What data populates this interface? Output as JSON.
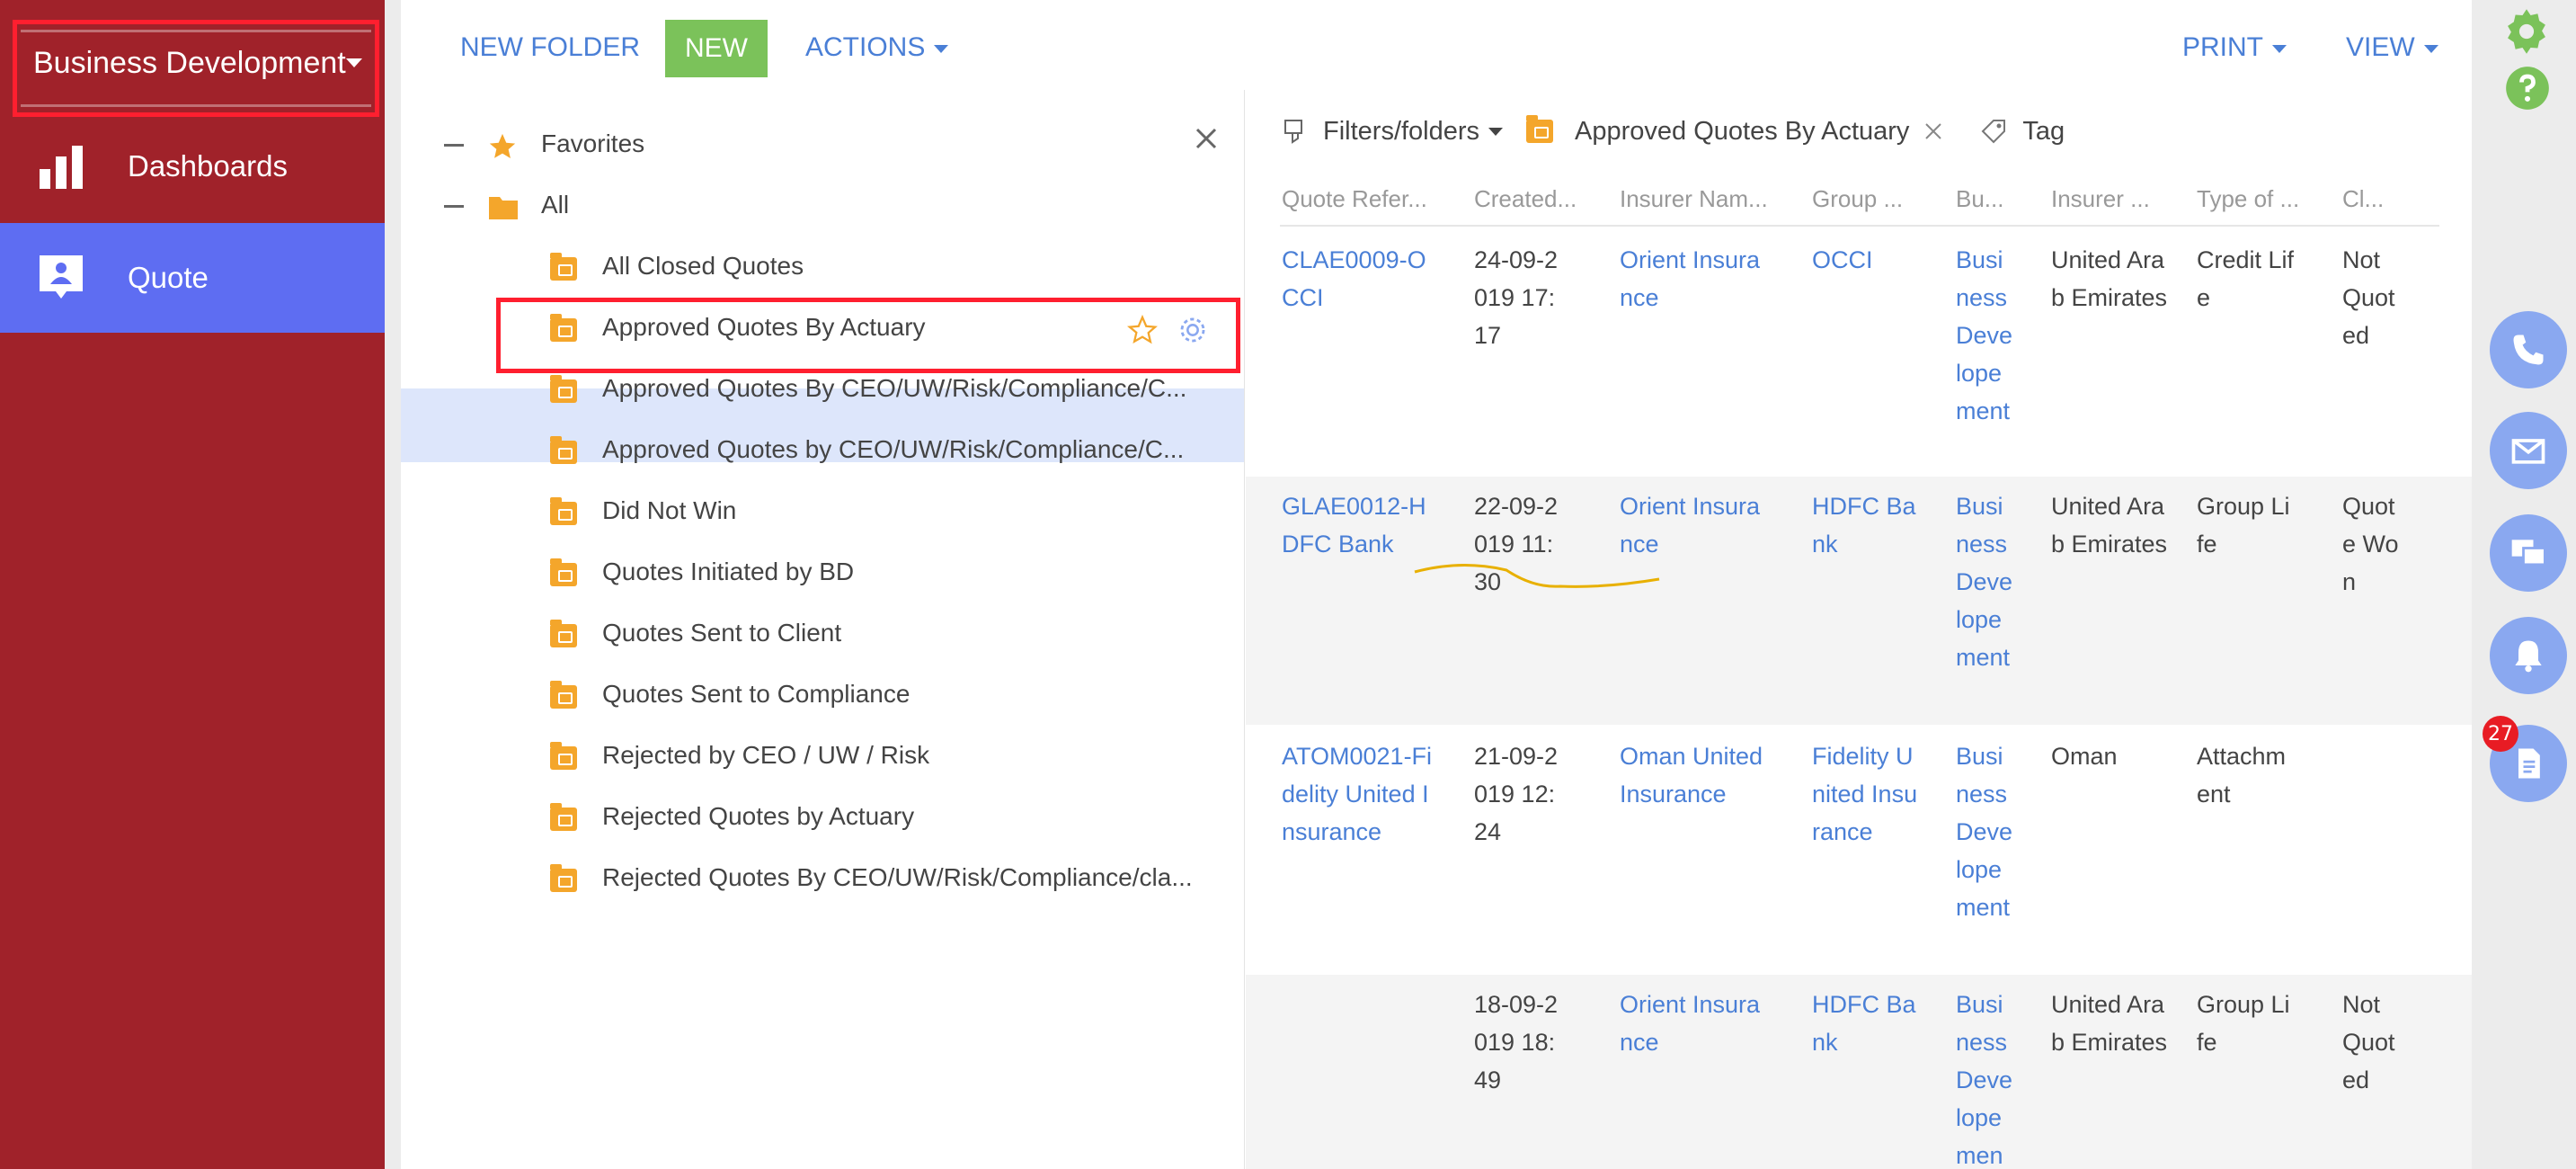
{
  "sidebar": {
    "workspace": "Business Development",
    "items": [
      {
        "label": "Dashboards"
      },
      {
        "label": "Quote"
      }
    ]
  },
  "toolbar": {
    "new_folder": "NEW FOLDER",
    "new": "NEW",
    "actions": "ACTIONS",
    "print": "PRINT",
    "view": "VIEW"
  },
  "folders": {
    "favorites": "Favorites",
    "all": "All",
    "items": [
      "All Closed Quotes",
      "Approved Quotes By Actuary",
      "Approved Quotes By CEO/UW/Risk/Compliance/C...",
      "Approved Quotes by CEO/UW/Risk/Compliance/C...",
      "Did Not Win",
      "Quotes Initiated by BD",
      "Quotes Sent to Client",
      "Quotes Sent to Compliance",
      "Rejected by CEO / UW / Risk",
      "Rejected Quotes by Actuary",
      "Rejected Quotes By CEO/UW/Risk/Compliance/cla..."
    ]
  },
  "filters": {
    "filters_folders": "Filters/folders",
    "active_folder": "Approved Quotes By Actuary",
    "tag": "Tag"
  },
  "grid": {
    "columns": [
      "Quote Refer...",
      "Created...",
      "Insurer Nam...",
      "Group ...",
      "Bu...",
      "Insurer ...",
      "Type of ...",
      "Cl..."
    ],
    "rows": [
      {
        "ref": "CLAE0009-OCCI",
        "created": "24-09-2019 17:17",
        "insurer": "Orient Insurance",
        "group": "OCCI",
        "bu": "Business Developement",
        "country": "United Arab Emirates",
        "type": "Credit Life",
        "status": "Not Quoted"
      },
      {
        "ref": "GLAE0012-HDFC Bank",
        "created": "22-09-2019 11:30",
        "insurer": "Orient Insurance",
        "group": "HDFC Bank",
        "bu": "Business Developement",
        "country": "United Arab Emirates",
        "type": "Group Life",
        "status": "Quote Won"
      },
      {
        "ref": "ATOM0021-Fidelity United Insurance",
        "created": "21-09-2019 12:24",
        "insurer": "Oman United Insurance",
        "group": "Fidelity United Insurance",
        "bu": "Business Developement",
        "country": "Oman",
        "type": "Attachment",
        "status": ""
      },
      {
        "ref": "",
        "created": "18-09-2019 18:49",
        "insurer": "Orient Insurance",
        "group": "HDFC Bank",
        "bu": "Business Developemen",
        "country": "United Arab Emirates",
        "type": "Group Life",
        "status": "Not Quoted"
      }
    ]
  },
  "rail": {
    "badge_count": "27"
  },
  "colors": {
    "sidebar": "#a0222a",
    "active_nav": "#5e6df2",
    "link": "#4a7fd6",
    "new_button": "#7bc25a",
    "folder": "#f4a62b",
    "highlight_box": "#ff1f2f"
  }
}
